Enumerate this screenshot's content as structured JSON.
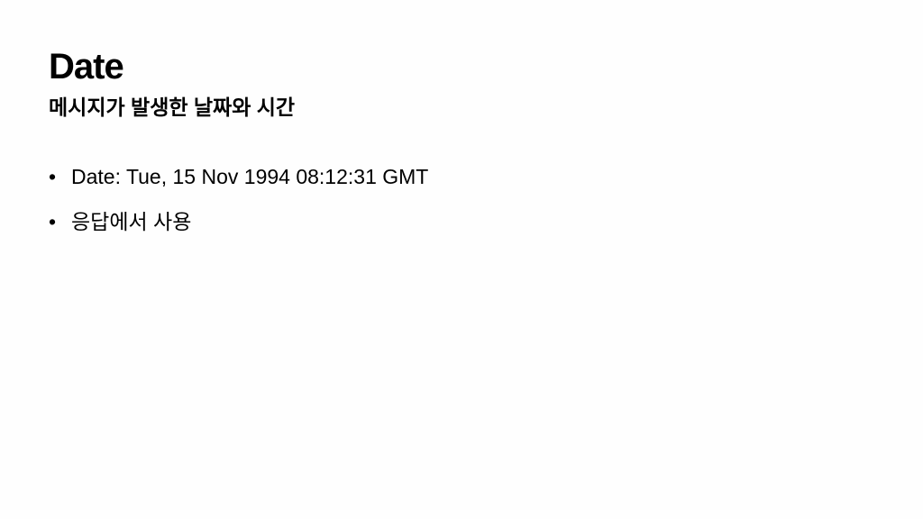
{
  "slide": {
    "title": "Date",
    "subtitle": "메시지가 발생한 날짜와 시간",
    "bullets": [
      {
        "text": "Date: Tue, 15 Nov 1994 08:12:31 GMT"
      },
      {
        "text": "응답에서 사용"
      }
    ],
    "bullet_symbol": "•"
  },
  "colors": {
    "background": "#fefefe",
    "text": "#000000"
  }
}
